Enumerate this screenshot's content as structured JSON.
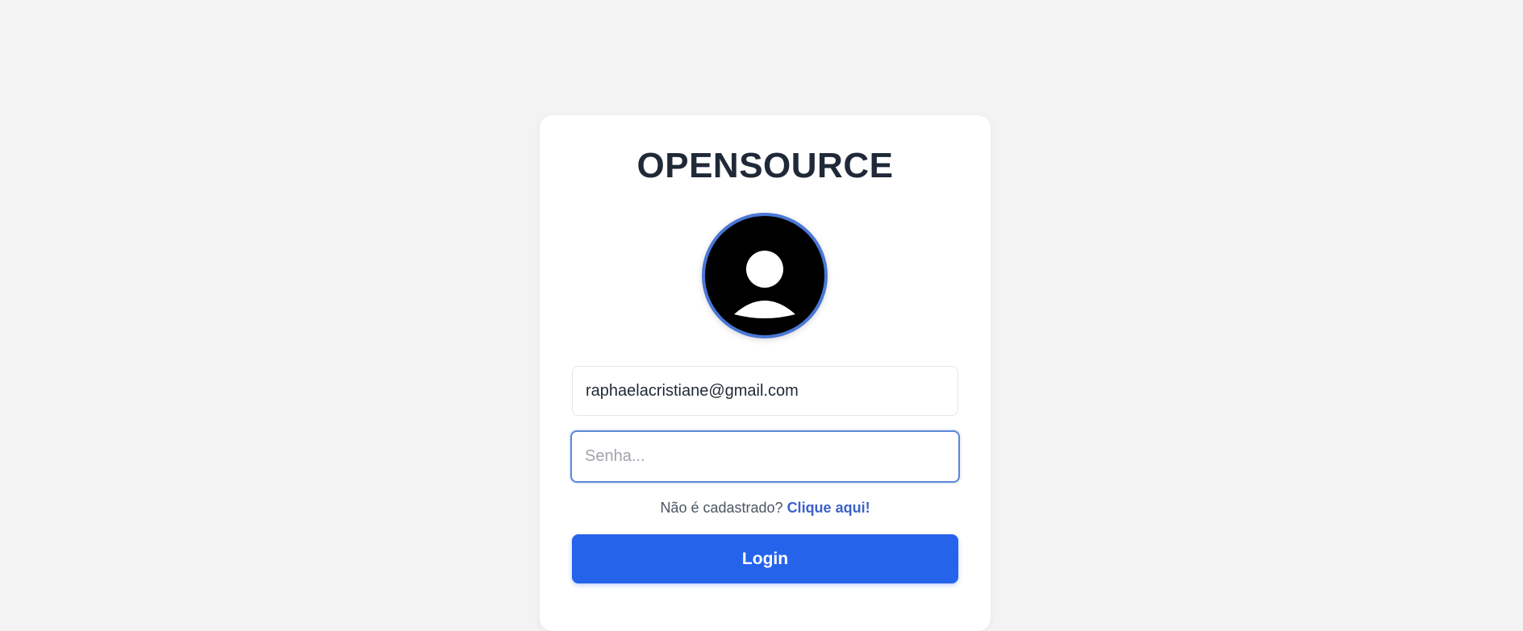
{
  "app": {
    "title": "OPENSOURCE"
  },
  "avatar": {
    "icon": "user-avatar-icon"
  },
  "login_form": {
    "email_value": "raphaelacristiane@gmail.com",
    "password_placeholder": "Senha...",
    "register_prompt": "Não é cadastrado?",
    "register_link": "Clique aqui!",
    "login_label": "Login"
  },
  "colors": {
    "background": "#f3f3f4",
    "card": "#ffffff",
    "accent": "#2563eb",
    "link": "#3b62c9",
    "focus_border": "#5b86d8",
    "title": "#1f2937"
  }
}
